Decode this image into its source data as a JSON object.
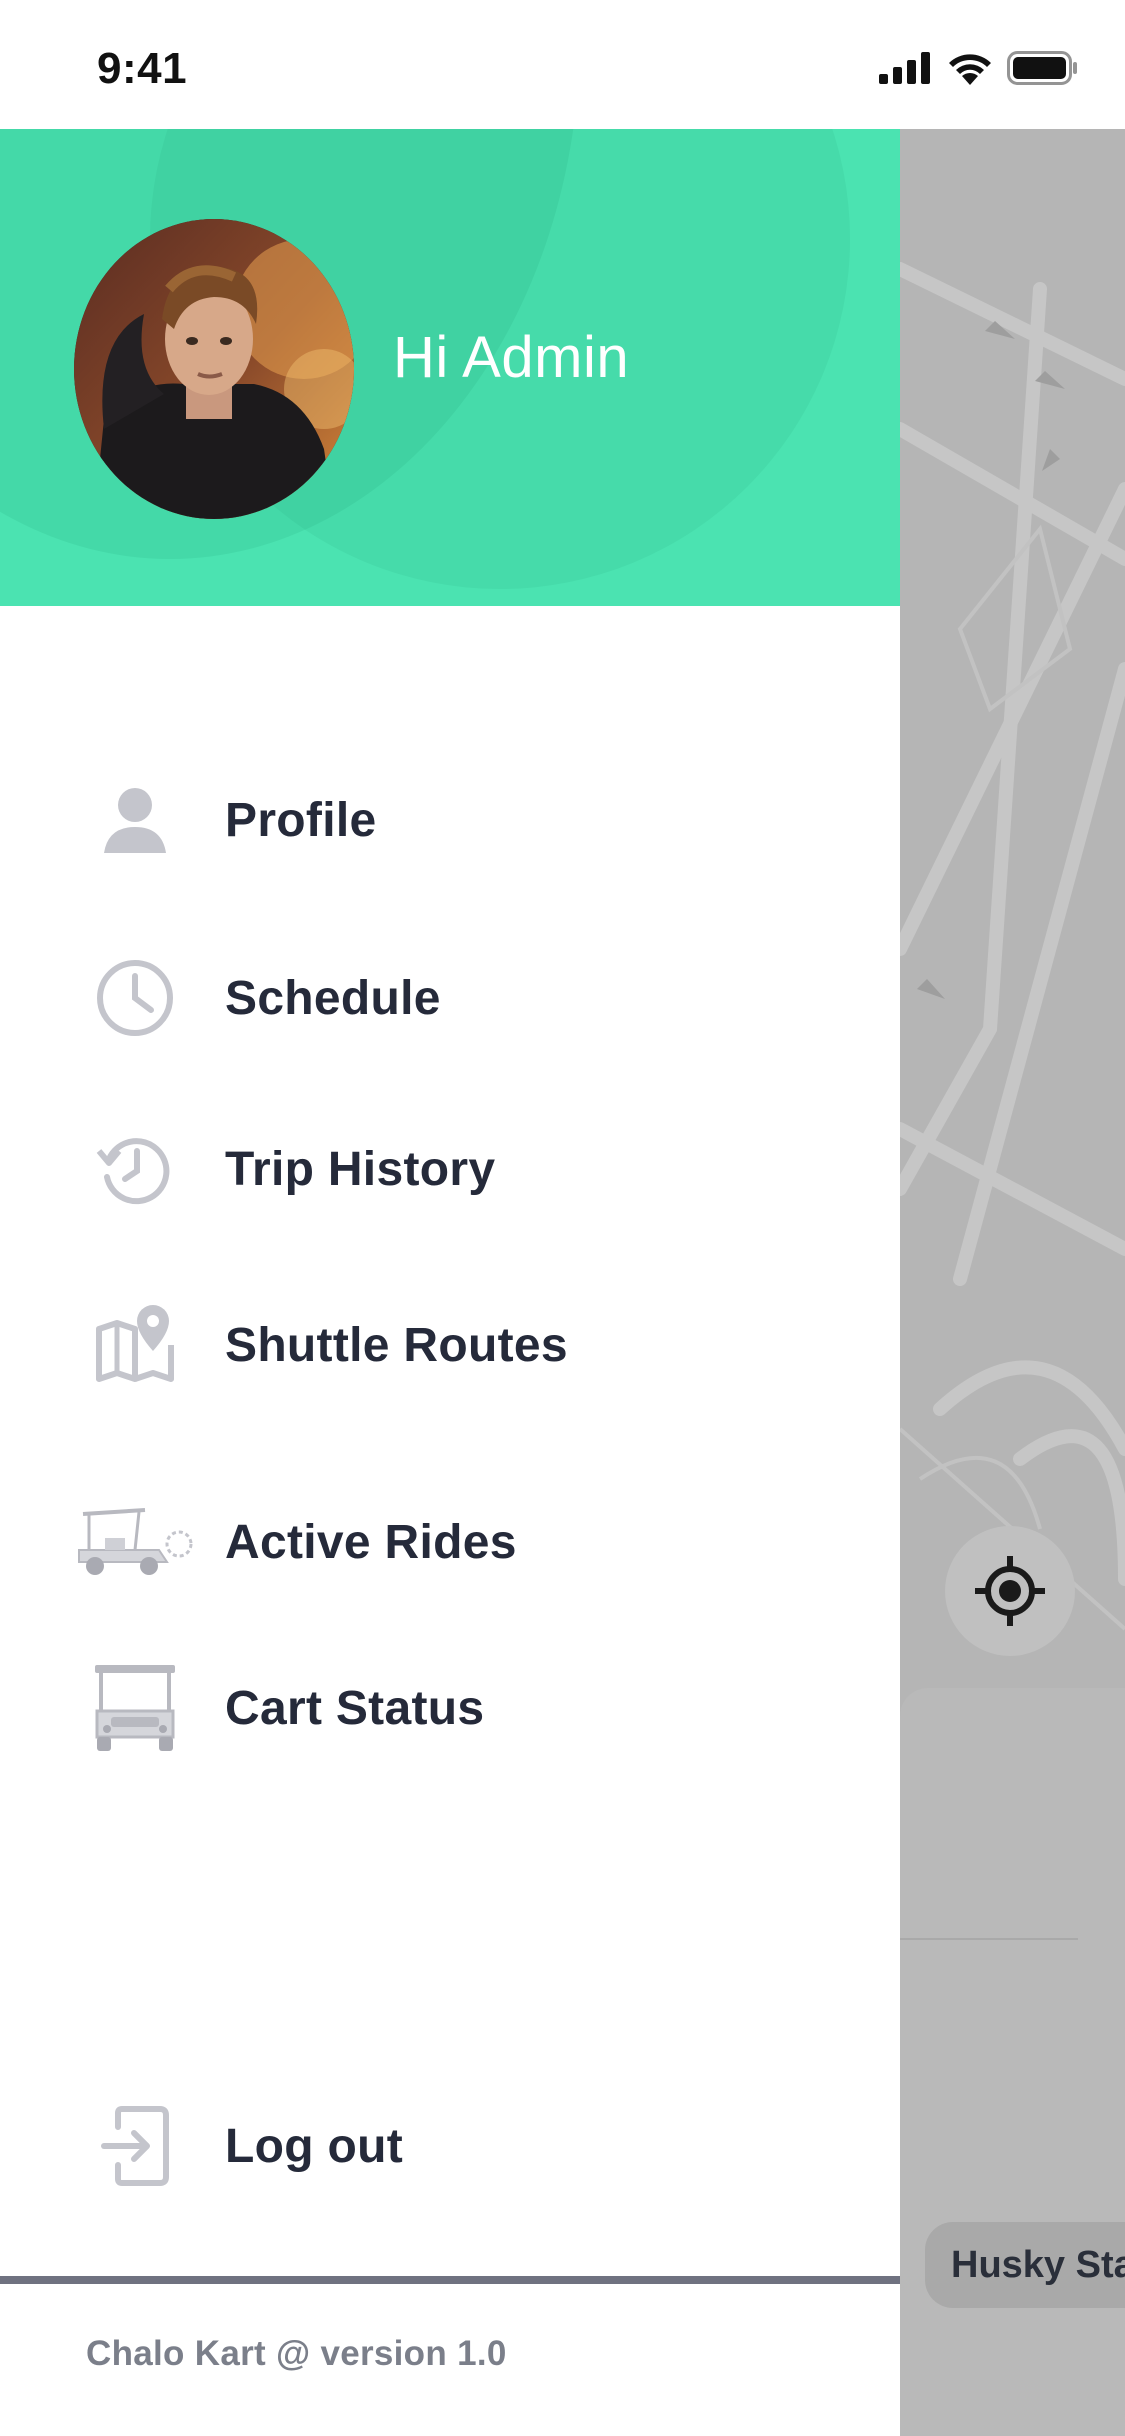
{
  "status_bar": {
    "time": "9:41",
    "icons": [
      "signal-icon",
      "wifi-icon",
      "battery-icon"
    ]
  },
  "drawer": {
    "greeting": "Hi Admin",
    "header_color": "#4be3b1",
    "menu": [
      {
        "label": "Profile",
        "icon": "person-icon"
      },
      {
        "label": "Schedule",
        "icon": "clock-icon"
      },
      {
        "label": "Trip History",
        "icon": "history-icon"
      },
      {
        "label": "Shuttle Routes",
        "icon": "map-pin-icon"
      },
      {
        "label": "Active Rides",
        "icon": "golf-cart-side-icon"
      },
      {
        "label": "Cart Status",
        "icon": "golf-cart-front-icon"
      }
    ],
    "logout": {
      "label": "Log out",
      "icon": "logout-icon"
    },
    "footer": "Chalo Kart @ version 1.0"
  },
  "map": {
    "station_label": "Husky Sta",
    "locate_icon": "crosshair-icon"
  }
}
